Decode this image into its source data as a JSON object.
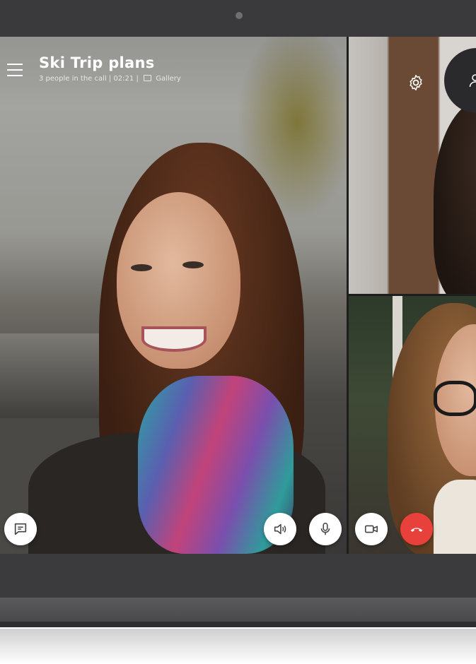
{
  "call": {
    "title": "Ski Trip plans",
    "participants_text": "3 people in the call",
    "duration": "02:21",
    "separator": "|",
    "view_mode": "Gallery"
  },
  "icons": {
    "menu": "hamburger-menu-icon",
    "gallery": "gallery-icon",
    "settings": "gear-icon",
    "participants": "person-icon",
    "chat": "chat-icon",
    "speaker": "speaker-icon",
    "microphone": "microphone-icon",
    "video": "video-camera-icon",
    "end_call": "hang-up-icon"
  },
  "colors": {
    "end_call": "#e8403a",
    "control_background": "#ffffff",
    "control_icon": "#444444",
    "bezel": "#3a3a3c"
  }
}
